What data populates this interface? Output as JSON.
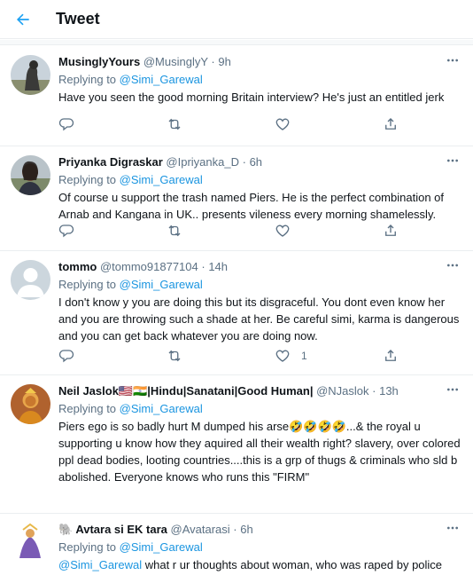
{
  "header": {
    "title": "Tweet"
  },
  "colors": {
    "accent": "#1da1f2",
    "link": "#1b95e0",
    "muted": "#5b7083"
  },
  "tweets": [
    {
      "name": "MusinglyYours",
      "handle": "@MusinglyY",
      "time": "9h",
      "replying_label": "Replying to",
      "replying_to": "@Simi_Garewal",
      "text": "Have you seen the good morning Britain interview? He's just an entitled jerk",
      "likes": ""
    },
    {
      "name": "Priyanka Digraskar",
      "handle": "@Ipriyanka_D",
      "time": "6h",
      "replying_label": "Replying to",
      "replying_to": "@Simi_Garewal",
      "text": "Of course u support the trash named Piers. He is the perfect combination of Arnab and Kangana in UK.. presents vileness every morning shamelessly.",
      "likes": ""
    },
    {
      "name": "tommo",
      "handle": "@tommo91877104",
      "time": "14h",
      "replying_label": "Replying to",
      "replying_to": "@Simi_Garewal",
      "text": "I don't know y you are doing this but its disgraceful. You dont even know her  and you are throwing such a shade at her. Be careful simi, karma is dangerous and you can get back whatever you are doing now.",
      "likes": "1"
    },
    {
      "name": "Neil Jaslok🇺🇸🇮🇳|Hindu|Sanatani|Good Human|",
      "handle": "@NJaslok",
      "time": "13h",
      "replying_label": "Replying to",
      "replying_to": "@Simi_Garewal",
      "text": "Piers ego is so badly hurt M dumped his arse🤣🤣🤣🤣...& the royal u supporting u know how they aquired all their wealth right? slavery, over colored ppl dead bodies, looting countries....this is a grp of thugs & criminals who sld b abolished. Everyone knows who runs this \"FIRM\"",
      "likes": ""
    },
    {
      "name": "🐘 Avtara si EK tara",
      "handle": "@Avatarasi",
      "time": "6h",
      "replying_label": "Replying to",
      "replying_to": "@Simi_Garewal",
      "text_mention": "@Simi_Garewal",
      "text": " what r ur thoughts about woman, who was raped by police",
      "likes": ""
    }
  ],
  "icons": [
    "back-arrow-icon",
    "more-icon",
    "reply-icon",
    "retweet-icon",
    "like-icon",
    "share-icon"
  ]
}
